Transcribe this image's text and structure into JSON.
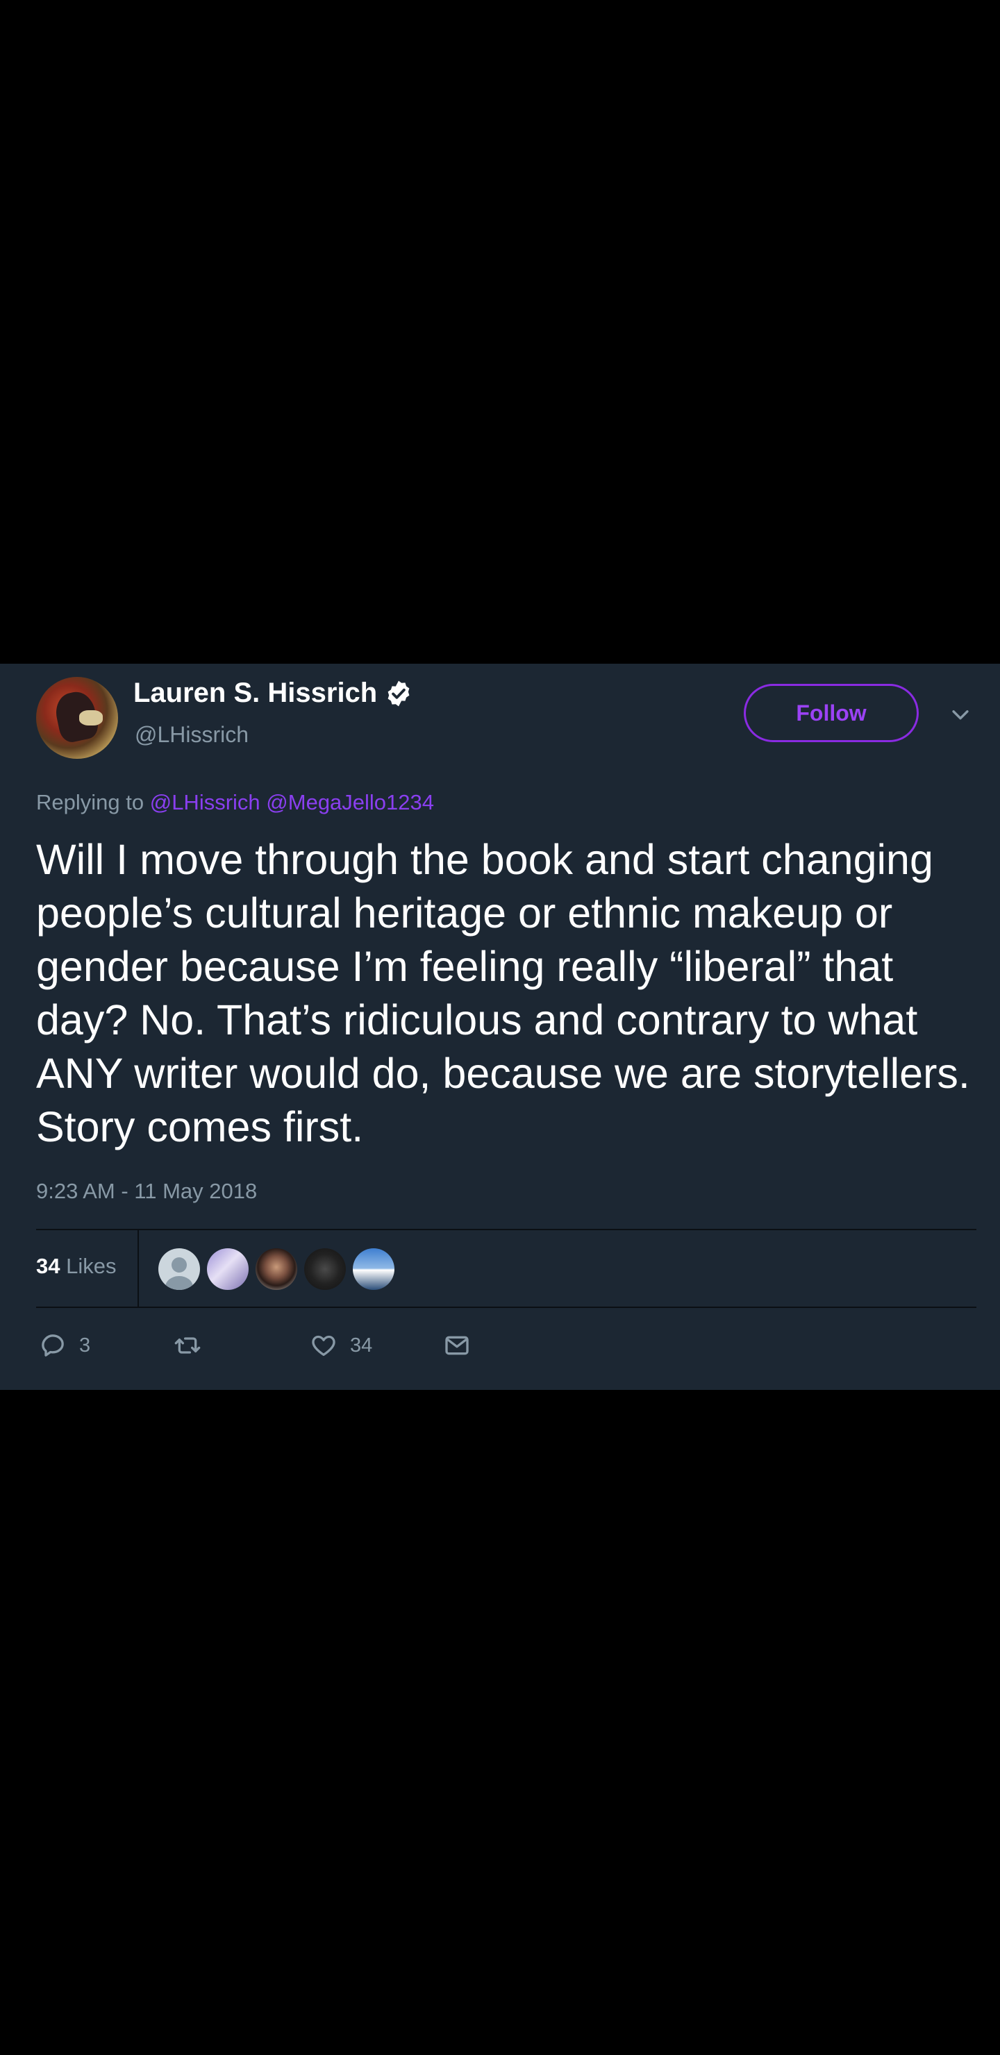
{
  "tweet": {
    "display_name": "Lauren S. Hissrich",
    "handle": "@LHissrich",
    "follow_label": "Follow",
    "replying_to_label": "Replying to",
    "reply_mentions": [
      "@LHissrich",
      "@MegaJello1234"
    ],
    "text": "Will I move through the book and start changing people’s cultural heritage or ethnic makeup or gender because I’m feeling really “liberal” that day? No. That’s ridiculous and contrary to what ANY writer would do, because we are storytellers. Story comes first.",
    "timestamp": "9:23 AM - 11 May 2018",
    "likes_count": "34",
    "likes_label": "Likes",
    "reply_count": "3",
    "like_count_action": "34"
  },
  "icons": {
    "verified": "verified-badge-icon",
    "chevron": "chevron-down-icon",
    "reply": "reply-icon",
    "retweet": "retweet-icon",
    "like": "heart-icon",
    "dm": "envelope-icon"
  },
  "colors": {
    "card_bg": "#1c2733",
    "accent": "#8a2be2",
    "muted": "#8899a6",
    "page_bg": "#000000"
  }
}
